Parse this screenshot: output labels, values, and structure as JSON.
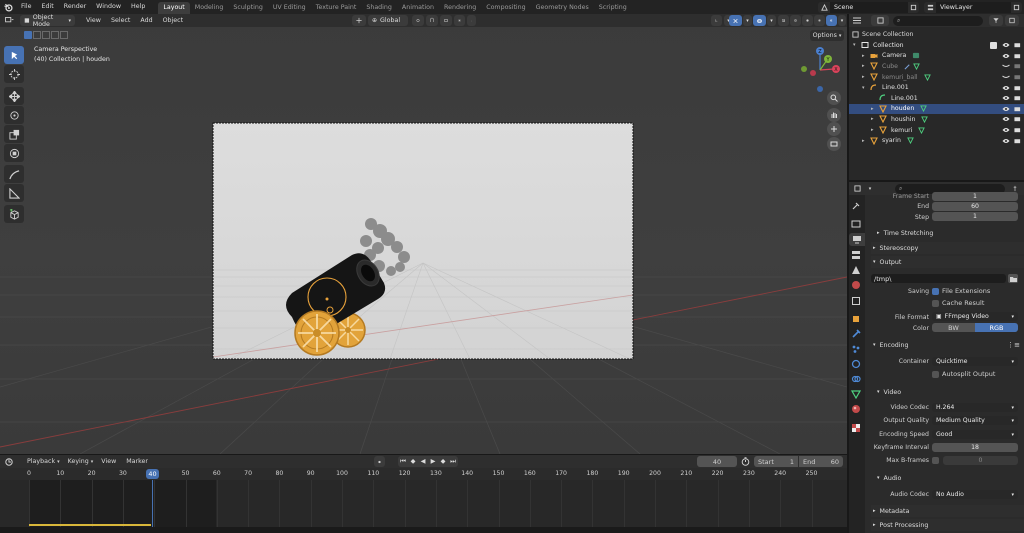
{
  "topbar": {
    "menus": [
      "File",
      "Edit",
      "Render",
      "Window",
      "Help"
    ],
    "workspaces": [
      "Layout",
      "Modeling",
      "Sculpting",
      "UV Editing",
      "Texture Paint",
      "Shading",
      "Animation",
      "Rendering",
      "Compositing",
      "Geometry Nodes",
      "Scripting"
    ],
    "active_workspace": "Layout",
    "scene": "Scene",
    "view_layer": "ViewLayer"
  },
  "viewport": {
    "mode": "Object Mode",
    "menus": [
      "View",
      "Select",
      "Add",
      "Object"
    ],
    "orientation": "Global",
    "camera_label": "Camera Perspective",
    "collection_label": "(40) Collection | houden",
    "options": "Options",
    "gizmo": {
      "x": "X",
      "y": "Y",
      "z": "Z"
    }
  },
  "outliner": {
    "root": "Scene Collection",
    "items": [
      {
        "name": "Collection",
        "indent": 1,
        "icon": "collection-icon",
        "color": "#e8e8e8"
      },
      {
        "name": "Camera",
        "indent": 2,
        "icon": "camera-icon",
        "color": "#e0e0e0"
      },
      {
        "name": "Cube",
        "indent": 2,
        "icon": "mesh-icon",
        "color": "#8a8a8a"
      },
      {
        "name": "kemuri_ball",
        "indent": 2,
        "icon": "mesh-icon",
        "color": "#8a8a8a"
      },
      {
        "name": "Line.001",
        "indent": 2,
        "icon": "curve-icon",
        "color": "#e0e0e0"
      },
      {
        "name": "Line.001",
        "indent": 3,
        "icon": "curve-data-icon",
        "color": "#e0e0e0"
      },
      {
        "name": "houden",
        "indent": 3,
        "icon": "mesh-icon",
        "color": "#ffffff",
        "selected": true
      },
      {
        "name": "houshin",
        "indent": 3,
        "icon": "mesh-icon",
        "color": "#e0e0e0"
      },
      {
        "name": "kemuri",
        "indent": 3,
        "icon": "mesh-icon",
        "color": "#e0e0e0"
      },
      {
        "name": "syarin",
        "indent": 2,
        "icon": "mesh-icon",
        "color": "#e0e0e0"
      }
    ]
  },
  "properties": {
    "frame_start_label": "Frame Start",
    "frame_start": "1",
    "end_label": "End",
    "end": "60",
    "step_label": "Step",
    "step": "1",
    "time_stretching": "Time Stretching",
    "stereoscopy": "Stereoscopy",
    "output": "Output",
    "output_path": "/tmp\\",
    "saving_label": "Saving",
    "file_extensions": "File Extensions",
    "cache_result": "Cache Result",
    "file_format_label": "File Format",
    "file_format": "FFmpeg Video",
    "color_label": "Color",
    "color_bw": "BW",
    "color_rgb": "RGB",
    "encoding": "Encoding",
    "container_label": "Container",
    "container": "Quicktime",
    "autosplit": "Autosplit Output",
    "video": "Video",
    "video_codec_label": "Video Codec",
    "video_codec": "H.264",
    "output_quality_label": "Output Quality",
    "output_quality": "Medium Quality",
    "encoding_speed_label": "Encoding Speed",
    "encoding_speed": "Good",
    "keyframe_interval_label": "Keyframe Interval",
    "keyframe_interval": "18",
    "max_bframes_label": "Max B-frames",
    "max_bframes": "0",
    "audio": "Audio",
    "audio_codec_label": "Audio Codec",
    "audio_codec": "No Audio",
    "metadata": "Metadata",
    "post_processing": "Post Processing"
  },
  "timeline": {
    "menus": [
      "Playback",
      "Keying",
      "View",
      "Marker"
    ],
    "current_frame": "40",
    "start_label": "Start",
    "start": "1",
    "end_label": "End",
    "end": "60",
    "ticks": [
      "0",
      "10",
      "20",
      "30",
      "40",
      "50",
      "60",
      "70",
      "80",
      "90",
      "100",
      "110",
      "120",
      "130",
      "140",
      "150",
      "160",
      "170",
      "180",
      "190",
      "200",
      "210",
      "220",
      "230",
      "240",
      "250"
    ],
    "playhead": "40"
  },
  "colors": {
    "accent": "#4772b3",
    "selection": "#334d80",
    "cannon_wheels": "#e2a33a",
    "object_orange": "#e8a23b"
  }
}
